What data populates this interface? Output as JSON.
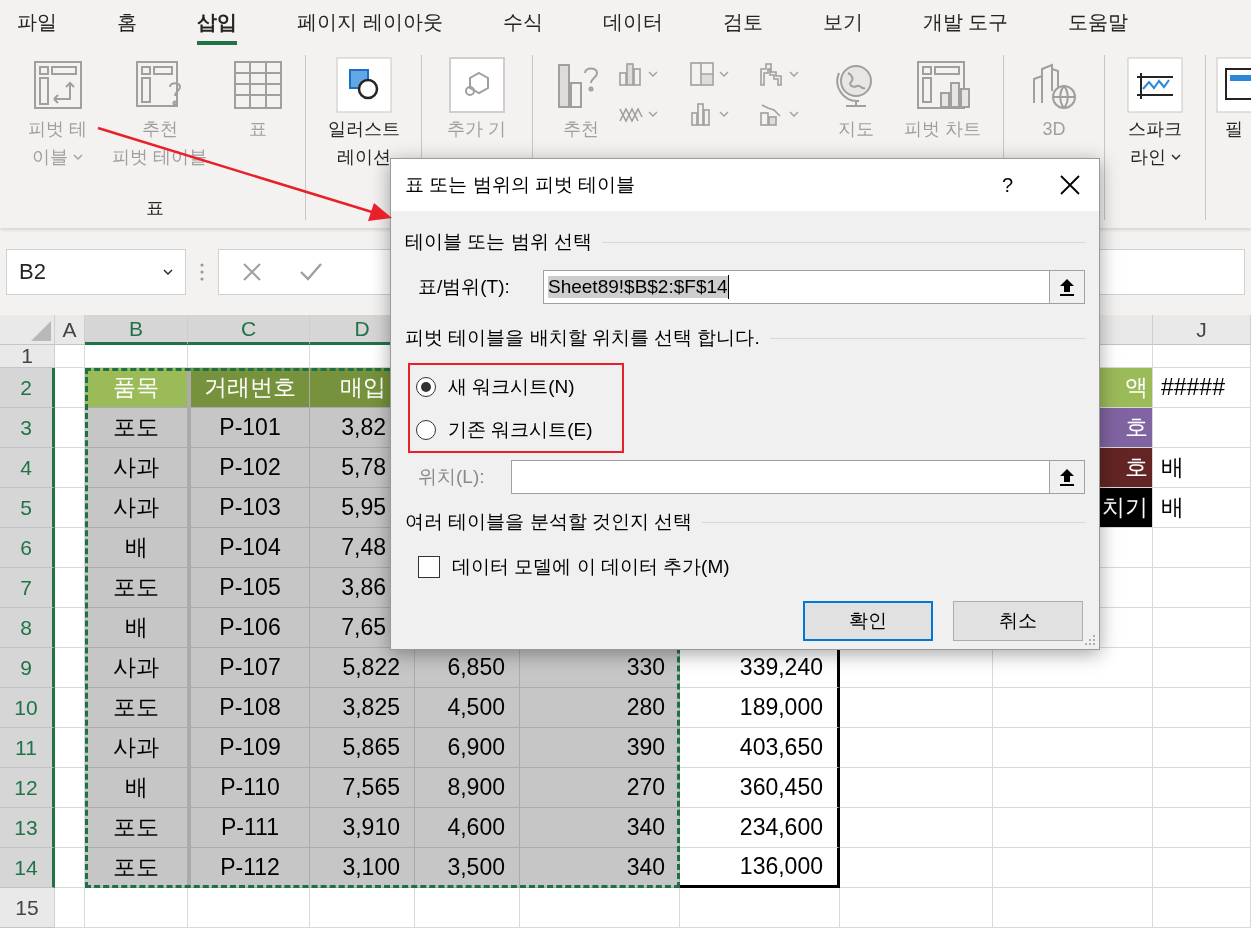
{
  "menu_tabs": [
    {
      "label": "파일",
      "selected": false
    },
    {
      "label": "홈",
      "selected": false
    },
    {
      "label": "삽입",
      "selected": true
    },
    {
      "label": "페이지 레이아웃",
      "selected": false
    },
    {
      "label": "수식",
      "selected": false
    },
    {
      "label": "데이터",
      "selected": false
    },
    {
      "label": "검토",
      "selected": false
    },
    {
      "label": "보기",
      "selected": false
    },
    {
      "label": "개발 도구",
      "selected": false
    },
    {
      "label": "도움말",
      "selected": false
    }
  ],
  "ribbon": {
    "groups": [
      {
        "label": "표",
        "items": [
          {
            "kind": "large",
            "lines": [
              "피벗 테",
              "이블"
            ],
            "dropdown": true,
            "disabled": true
          },
          {
            "kind": "large",
            "lines": [
              "추천",
              "피벗 테이블"
            ],
            "dropdown": false,
            "disabled": true
          },
          {
            "kind": "large",
            "lines": [
              "표"
            ],
            "dropdown": false,
            "disabled": true
          }
        ]
      },
      {
        "items": [
          {
            "kind": "large",
            "lines": [
              "일러스트",
              "레이션"
            ],
            "dropdown": false,
            "disabled": false
          }
        ]
      },
      {
        "items": [
          {
            "kind": "large",
            "lines": [
              "추가 기"
            ],
            "dropdown": false,
            "disabled": true
          }
        ]
      },
      {
        "items": [
          {
            "kind": "large",
            "lines": [
              "추천"
            ],
            "dropdown": false,
            "disabled": true
          },
          {
            "kind": "chart-grid",
            "buttons": [
              {
                "disabled": true
              },
              {
                "disabled": true
              },
              {
                "disabled": true
              },
              {
                "disabled": true
              },
              {
                "disabled": true
              },
              {
                "disabled": true
              }
            ]
          },
          {
            "kind": "large",
            "lines": [
              "지도"
            ],
            "dropdown": false,
            "disabled": true
          },
          {
            "kind": "large",
            "lines": [
              "피벗 차트"
            ],
            "dropdown": false,
            "disabled": true
          }
        ]
      },
      {
        "items": [
          {
            "kind": "large",
            "lines": [
              "3D"
            ],
            "dropdown": false,
            "disabled": true
          }
        ]
      },
      {
        "items": [
          {
            "kind": "large",
            "lines": [
              "스파크",
              "라인"
            ],
            "dropdown": true,
            "disabled": false
          }
        ]
      },
      {
        "items": [
          {
            "kind": "large",
            "lines": [
              "필"
            ],
            "dropdown": false,
            "disabled": false
          }
        ]
      }
    ]
  },
  "formula_bar": {
    "name_box": "B2"
  },
  "sheet": {
    "columns": [
      {
        "label": "A",
        "selected": false
      },
      {
        "label": "B",
        "selected": true
      },
      {
        "label": "C",
        "selected": true
      },
      {
        "label": "D",
        "selected": true
      },
      {
        "selected": true
      },
      {
        "selected": true
      },
      {
        "selected": false
      },
      {
        "selected": false
      },
      {
        "selected": false
      },
      {
        "label": "J",
        "selected": false
      }
    ],
    "rows": [
      {
        "number": "1",
        "selected": false
      },
      {
        "number": "2",
        "selected": true,
        "cells": [
          null,
          {
            "text": "품목",
            "color": "#9bbb59"
          },
          {
            "text": "거래번호",
            "color": "#76923c"
          },
          {
            "text": "매입",
            "color": "#76923c"
          },
          null,
          null,
          null,
          null,
          {
            "text": "액",
            "color": "#9bbb59"
          },
          "#####"
        ]
      },
      {
        "number": "3",
        "selected": true,
        "cells": [
          null,
          "포도",
          "P-101",
          "3,82",
          null,
          null,
          null,
          null,
          {
            "text": "호",
            "color": "#8064a2"
          },
          null
        ]
      },
      {
        "number": "4",
        "selected": true,
        "cells": [
          null,
          "사과",
          "P-102",
          "5,78",
          null,
          null,
          null,
          null,
          {
            "text": "호",
            "color": "#632523"
          },
          "배"
        ]
      },
      {
        "number": "5",
        "selected": true,
        "cells": [
          null,
          "사과",
          "P-103",
          "5,95",
          null,
          null,
          null,
          null,
          {
            "text": "치기",
            "color": "#000000"
          },
          "배"
        ]
      },
      {
        "number": "6",
        "selected": true,
        "cells": [
          null,
          "배",
          "P-104",
          "7,48"
        ]
      },
      {
        "number": "7",
        "selected": true,
        "cells": [
          null,
          "포도",
          "P-105",
          "3,86"
        ]
      },
      {
        "number": "8",
        "selected": true,
        "cells": [
          null,
          "배",
          "P-106",
          "7,65"
        ]
      },
      {
        "number": "9",
        "selected": true,
        "cells": [
          null,
          "사과",
          "P-107",
          "5,822",
          "6,850",
          "330",
          "339,240"
        ]
      },
      {
        "number": "10",
        "selected": true,
        "cells": [
          null,
          "포도",
          "P-108",
          "3,825",
          "4,500",
          "280",
          "189,000"
        ]
      },
      {
        "number": "11",
        "selected": true,
        "cells": [
          null,
          "사과",
          "P-109",
          "5,865",
          "6,900",
          "390",
          "403,650"
        ]
      },
      {
        "number": "12",
        "selected": true,
        "cells": [
          null,
          "배",
          "P-110",
          "7,565",
          "8,900",
          "270",
          "360,450"
        ]
      },
      {
        "number": "13",
        "selected": true,
        "cells": [
          null,
          "포도",
          "P-111",
          "3,910",
          "4,600",
          "340",
          "234,600"
        ]
      },
      {
        "number": "14",
        "selected": true,
        "cells": [
          null,
          "포도",
          "P-112",
          "3,100",
          "3,500",
          "340",
          "136,000"
        ]
      },
      {
        "number": "15",
        "selected": false
      }
    ]
  },
  "dialog": {
    "title": "표 또는 범위의 피벗 테이블",
    "help_button": "?",
    "range_section": {
      "heading": "테이블 또는 범위 선택",
      "label": "표/범위(T):",
      "value": "Sheet89!$B$2:$F$14"
    },
    "location_section": {
      "heading": "피벗 테이블을 배치할 위치를 선택 합니다.",
      "options": [
        {
          "label": "새 워크시트(N)",
          "selected": true
        },
        {
          "label": "기존 워크시트(E)",
          "selected": false
        }
      ],
      "location_label": "위치(L):",
      "location_disabled": true
    },
    "model_section": {
      "heading": "여러 테이블을 분석할 것인지 선택",
      "checkbox": {
        "label": "데이터 모델에 이 데이터 추가(M)",
        "checked": false
      }
    },
    "buttons": [
      {
        "label": "확인",
        "default": true
      },
      {
        "label": "취소",
        "default": false
      }
    ]
  }
}
